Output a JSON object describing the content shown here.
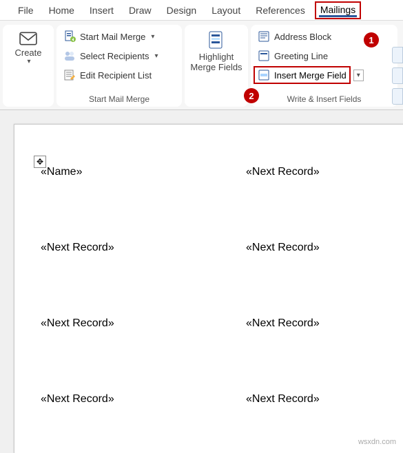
{
  "tabs": [
    "File",
    "Home",
    "Insert",
    "Draw",
    "Design",
    "Layout",
    "References",
    "Mailings"
  ],
  "active_tab_index": 7,
  "ribbon": {
    "create": {
      "label": "Create"
    },
    "start_mail_merge": {
      "start": "Start Mail Merge",
      "select": "Select Recipients",
      "edit": "Edit Recipient List",
      "group_label": "Start Mail Merge"
    },
    "highlight": {
      "label": "Highlight\nMerge Fields"
    },
    "write_insert": {
      "address_block": "Address Block",
      "greeting_line": "Greeting Line",
      "insert_merge_field": "Insert Merge Field",
      "group_label": "Write & Insert Fields"
    }
  },
  "callouts": {
    "one": "1",
    "two": "2"
  },
  "document": {
    "cells": [
      "«Name»",
      "«Next Record»",
      "«Next Record»",
      "«Next Record»",
      "«Next Record»",
      "«Next Record»",
      "«Next Record»",
      "«Next Record»"
    ]
  },
  "watermark": "wsxdn.com"
}
